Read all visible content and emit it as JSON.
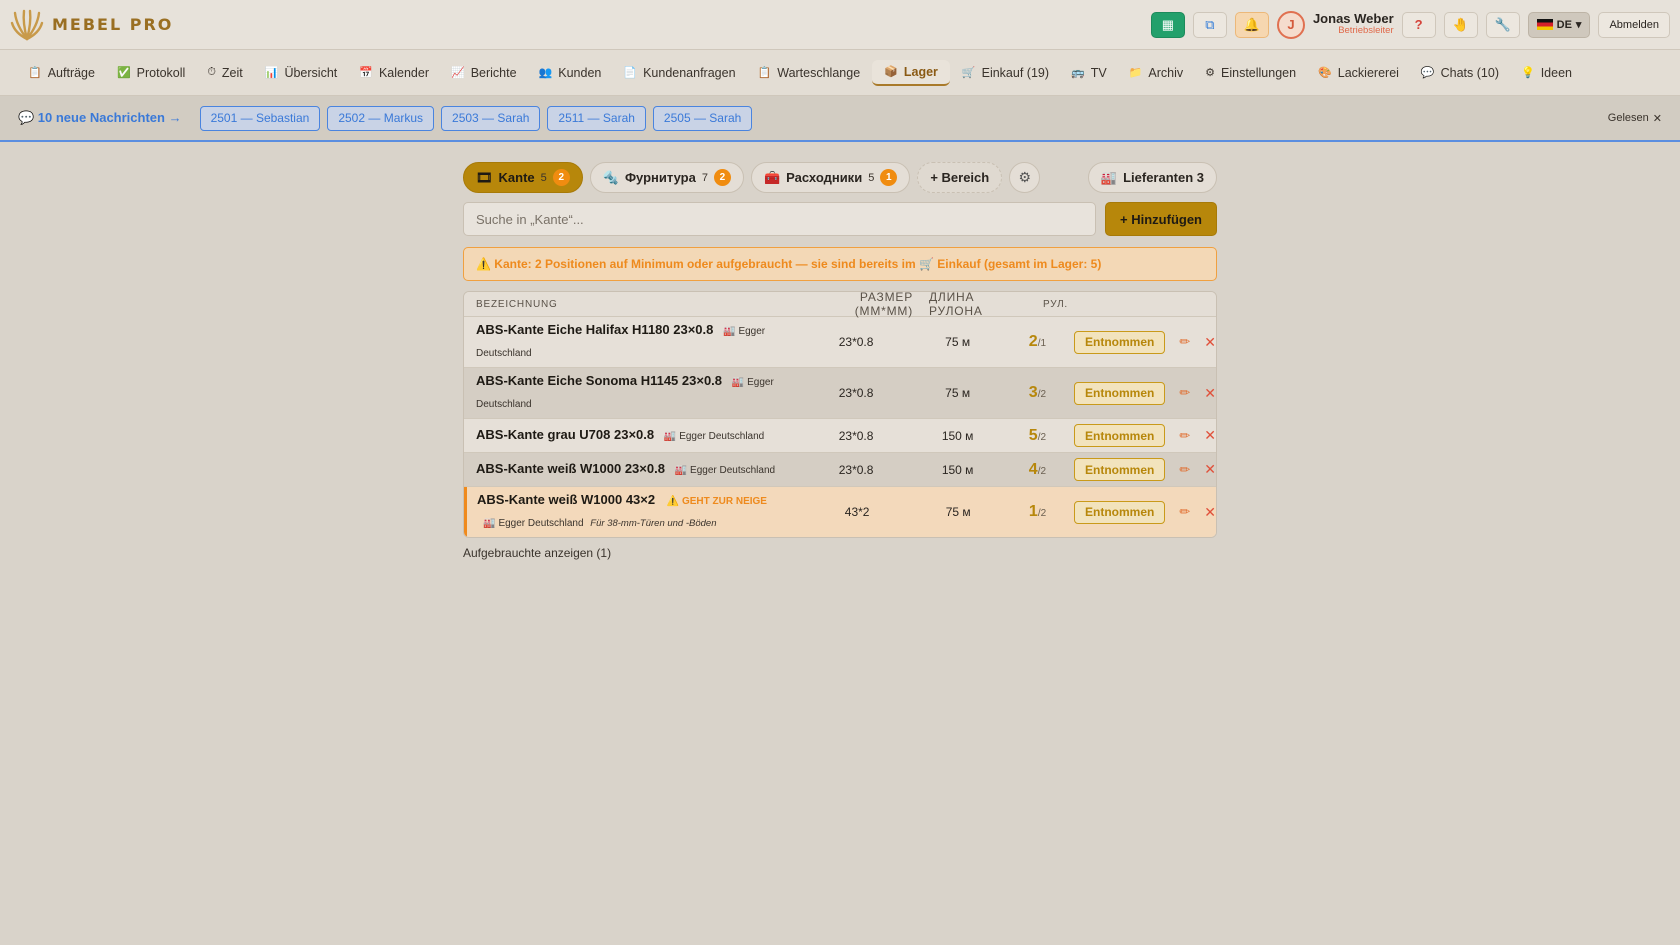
{
  "app": {
    "name": "MEBEL PRO"
  },
  "header": {
    "user_initial": "J",
    "user_name": "Jonas Weber",
    "user_role": "Betriebsleiter",
    "lang": "DE",
    "logout": "Abmelden",
    "help_label": "?",
    "btn_icons": [
      "calculator-icon",
      "window-icon",
      "bell-icon",
      "hand-icon",
      "wrench-icon"
    ]
  },
  "nav": [
    {
      "icon": "📋",
      "label": "Aufträge"
    },
    {
      "icon": "✅",
      "label": "Protokoll"
    },
    {
      "icon": "⏱",
      "label": "Zeit"
    },
    {
      "icon": "📊",
      "label": "Übersicht"
    },
    {
      "icon": "📅",
      "label": "Kalender"
    },
    {
      "icon": "📈",
      "label": "Berichte"
    },
    {
      "icon": "👥",
      "label": "Kunden"
    },
    {
      "icon": "📄",
      "label": "Kundenanfragen"
    },
    {
      "icon": "📋",
      "label": "Warteschlange"
    },
    {
      "icon": "📦",
      "label": "Lager",
      "active": true
    },
    {
      "icon": "🛒",
      "label": "Einkauf (19)"
    },
    {
      "icon": "🚌",
      "label": "TV"
    },
    {
      "icon": "📁",
      "label": "Archiv"
    },
    {
      "icon": "⚙",
      "label": "Einstellungen"
    },
    {
      "icon": "🎨",
      "label": "Lackiererei"
    },
    {
      "icon": "💬",
      "label": "Chats (10)"
    },
    {
      "icon": "💡",
      "label": "Ideen"
    }
  ],
  "messages": {
    "title": "💬 10 neue Nachrichten →",
    "chips": [
      "2501 — Sebastian",
      "2502 — Markus",
      "2503 — Sarah",
      "2511 — Sarah",
      "2505 — Sarah"
    ],
    "read_label": "Gelesen"
  },
  "tabs": {
    "kante": {
      "label": "Kante",
      "count": "5",
      "badge": "2"
    },
    "furnitura": {
      "label": "Фурнитура",
      "count": "7",
      "badge": "2"
    },
    "rashodniki": {
      "label": "Расходники",
      "count": "5",
      "badge": "1"
    },
    "add_area": "+ Bereich",
    "suppliers": "Lieferanten 3"
  },
  "search": {
    "placeholder": "Suche in „Kante“...",
    "add_label": "+ Hinzufügen"
  },
  "alert": "⚠️ Kante: 2 Positionen auf Minimum oder aufgebraucht — sie sind bereits im 🛒 Einkauf (gesamt im Lager: 5)",
  "table": {
    "headers": {
      "name": "BEZEICHNUNG",
      "size": "РАЗМЕР (ММ*ММ)",
      "len": "ДЛИНА РУЛОНА",
      "rul": "РУЛ."
    },
    "take_label": "Entnommen",
    "rows": [
      {
        "name": "ABS-Kante Eiche Halifax H1180 23×0.8",
        "supplier": "Egger Deutschland",
        "size": "23*0.8",
        "len": "75 м",
        "qty": "2",
        "min": "/1"
      },
      {
        "name": "ABS-Kante Eiche Sonoma H1145 23×0.8",
        "supplier": "Egger Deutschland",
        "size": "23*0.8",
        "len": "75 м",
        "qty": "3",
        "min": "/2"
      },
      {
        "name": "ABS-Kante grau U708 23×0.8",
        "supplier": "Egger Deutschland",
        "size": "23*0.8",
        "len": "150 м",
        "qty": "5",
        "min": "/2"
      },
      {
        "name": "ABS-Kante weiß W1000 23×0.8",
        "supplier": "Egger Deutschland",
        "size": "23*0.8",
        "len": "150 м",
        "qty": "4",
        "min": "/2"
      },
      {
        "name": "ABS-Kante weiß W1000 43×2",
        "low": "⚠️ GEHT ZUR NEIGE",
        "supplier": "Egger Deutschland",
        "note": "Für 38-mm-Türen und -Böden",
        "size": "43*2",
        "len": "75 м",
        "qty": "1",
        "min": "/2"
      }
    ]
  },
  "used_link": "Aufgebrauchte anzeigen (1)"
}
